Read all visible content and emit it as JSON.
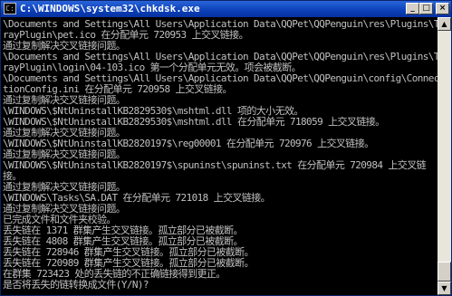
{
  "window": {
    "title": "C:\\WINDOWS\\system32\\chkdsk.exe",
    "icon": "console-icon",
    "controls": {
      "minimize": "_",
      "maximize": "□",
      "close": "×"
    }
  },
  "console": {
    "lines": [
      "\\Documents and Settings\\All Users\\Application Data\\QQPet\\QQPenguin\\res\\Plugins\\T",
      "rayPlugin\\pet.ico 在分配单元 720953 上交叉链接。",
      "通过复制解决交叉链接问题。",
      "\\Documents and Settings\\All Users\\Application Data\\QQPet\\QQPenguin\\res\\Plugins\\T",
      "rayPlugin\\login\\04-103.ico 第一个分配单元无效。项会被截断。",
      "\\Documents and Settings\\All Users\\Application Data\\QQPet\\QQPenguin\\config\\Connec",
      "tionConfig.ini 在分配单元 720958 上交叉链接。",
      "通过复制解决交叉链接问题。",
      "\\WINDOWS\\$NtUninstallKB2829530$\\mshtml.dll 项的大小无效。",
      "\\WINDOWS\\$NtUninstallKB2829530$\\mshtml.dll 在分配单元 718059 上交叉链接。",
      "通过复制解决交叉链接问题。",
      "\\WINDOWS\\$NtUninstallKB2820197$\\reg00001 在分配单元 720976 上交叉链接。",
      "通过复制解决交叉链接问题。",
      "\\WINDOWS\\$NtUninstallKB2820197$\\spuninst\\spuninst.txt 在分配单元 720984 上交叉链",
      "接。",
      "通过复制解决交叉链接问题。",
      "\\WINDOWS\\Tasks\\SA.DAT 在分配单元 721018 上交叉链接。",
      "通过复制解决交叉链接问题。",
      "已完成文件和文件夹校验。",
      "丢失链在 1371 群集产生交叉链接。孤立部分已被截断。",
      "丢失链在 4808 群集产生交叉链接。孤立部分已被截断。",
      "丢失链在 728946 群集产生交叉链接。孤立部分已被截断。",
      "丢失链在 720989 群集产生交叉链接。孤立部分已被截断。",
      "在群集 723423 处的丢失链的不正确链接得到更正。",
      "是否将丢失的链转换成文件(Y/N)?"
    ]
  },
  "scrollbar": {
    "up": "▲",
    "down": "▼"
  }
}
